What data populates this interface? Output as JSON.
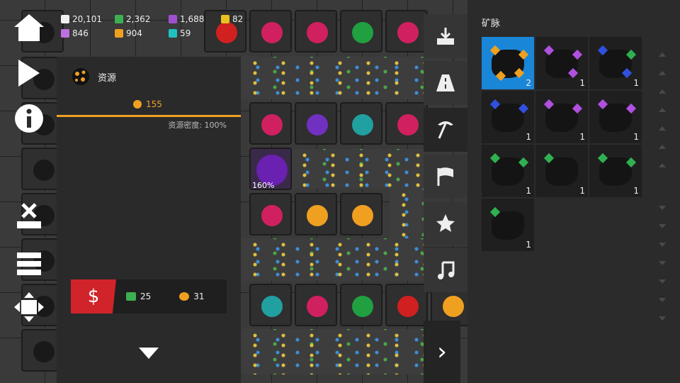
{
  "top_resources": {
    "r1": {
      "value": "20,101",
      "color": "#f0f0f0",
      "icon": "cargo-icon"
    },
    "r2": {
      "value": "846",
      "color": "#c070e0",
      "icon": "purple-crystal-icon"
    },
    "r3": {
      "value": "2,362",
      "color": "#3cb050",
      "icon": "green-ore-icon"
    },
    "r4": {
      "value": "904",
      "color": "#f0a020",
      "icon": "orange-ore-icon"
    },
    "r5": {
      "value": "1,688",
      "color": "#a050d0",
      "icon": "violet-shard-icon"
    },
    "r6": {
      "value": "59",
      "color": "#20c0c0",
      "icon": "cyan-shard-icon"
    },
    "r7": {
      "value": "82",
      "color": "#e8c020",
      "icon": "gold-pentagon-icon"
    }
  },
  "resource_panel": {
    "title": "资源",
    "amount": "155",
    "density": "资源密度: 100%",
    "progress": 1.0,
    "cost": {
      "sell_glyph": "$",
      "green": "25",
      "orange": "31"
    }
  },
  "map_label": "160%",
  "right_panel": {
    "title": "矿脉",
    "tiles": [
      {
        "count": "2",
        "gems": [
          "#f0a020",
          "#f0a020",
          "#f0a020",
          "#f0a020"
        ]
      },
      {
        "count": "1",
        "gems": [
          "#b050e0",
          "#b050e0",
          "#b050e0"
        ]
      },
      {
        "count": "1",
        "gems": [
          "#3050e0",
          "#30b050",
          "#3050e0"
        ]
      },
      {
        "count": "1",
        "gems": [
          "#3050e0",
          "#3050e0"
        ]
      },
      {
        "count": "1",
        "gems": [
          "#b050e0",
          "#b050e0"
        ]
      },
      {
        "count": "1",
        "gems": [
          "#b050e0",
          "#b050e0"
        ]
      },
      {
        "count": "1",
        "gems": [
          "#30b050",
          "#30b050"
        ]
      },
      {
        "count": "1",
        "gems": [
          "#30b050"
        ]
      },
      {
        "count": "1",
        "gems": [
          "#30b050",
          "#30b050"
        ]
      },
      {
        "count": "1",
        "gems": [
          "#30b050"
        ]
      }
    ]
  },
  "toolbar": [
    "download-tray-icon",
    "road-icon",
    "pickaxe-icon",
    "flag-icon",
    "star-icon",
    "music-note-icon"
  ],
  "next_glyph": "›"
}
